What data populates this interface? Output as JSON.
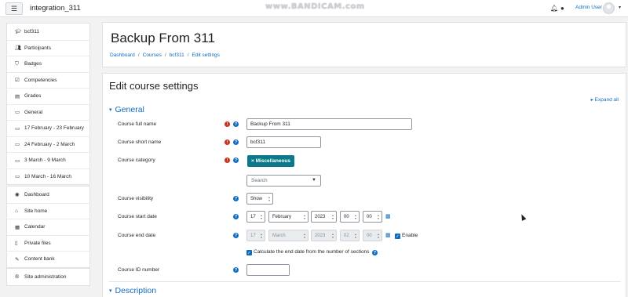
{
  "navbar": {
    "site_name": "integration_311",
    "watermark": "www.BANDICAM.com",
    "user_name": "Admin User",
    "icons": [
      "menu-icon",
      "bell-icon",
      "chat-icon",
      "caret-down-icon"
    ]
  },
  "drawer": {
    "course_items": [
      {
        "label": "bcf311",
        "icon": "graduation-cap-icon"
      },
      {
        "label": "Participants",
        "icon": "users-icon"
      },
      {
        "label": "Badges",
        "icon": "shield-icon"
      },
      {
        "label": "Competencies",
        "icon": "check-square-icon"
      },
      {
        "label": "Grades",
        "icon": "table-icon"
      },
      {
        "label": "General",
        "icon": "folder-icon"
      },
      {
        "label": "17 February - 23 February",
        "icon": "folder-icon"
      },
      {
        "label": "24 February - 2 March",
        "icon": "folder-icon"
      },
      {
        "label": "3 March - 9 March",
        "icon": "folder-icon"
      },
      {
        "label": "10 March - 16 March",
        "icon": "folder-icon"
      }
    ],
    "site_items": [
      {
        "label": "Dashboard",
        "icon": "dashboard-icon"
      },
      {
        "label": "Site home",
        "icon": "home-icon"
      },
      {
        "label": "Calendar",
        "icon": "calendar-icon"
      },
      {
        "label": "Private files",
        "icon": "file-icon"
      },
      {
        "label": "Content bank",
        "icon": "paint-brush-icon"
      }
    ],
    "admin_items": [
      {
        "label": "Site administration",
        "icon": "wrench-icon"
      }
    ]
  },
  "header": {
    "page_title": "Backup From 311",
    "breadcrumb": [
      "Dashboard",
      "Courses",
      "bcf311",
      "Edit settings"
    ]
  },
  "form": {
    "title": "Edit course settings",
    "expand_all": "Expand all",
    "section_general": "General",
    "section_description": "Description",
    "fields": {
      "full_name": {
        "label": "Course full name",
        "value": "Backup From 311"
      },
      "short_name": {
        "label": "Course short name",
        "value": "bcf311"
      },
      "category": {
        "label": "Course category",
        "tag": "Miscellaneous",
        "search_placeholder": "Search"
      },
      "visibility": {
        "label": "Course visibility",
        "value": "Show"
      },
      "start_date": {
        "label": "Course start date",
        "day": "17",
        "month": "February",
        "year": "2023",
        "hour": "00",
        "minute": "00"
      },
      "end_date": {
        "label": "Course end date",
        "day": "17",
        "month": "March",
        "year": "2023",
        "hour": "02",
        "minute": "00",
        "enable_label": "Enable"
      },
      "calc_end_date": {
        "label": "Calculate the end date from the number of sections",
        "checked": true
      },
      "id_number": {
        "label": "Course ID number",
        "value": ""
      }
    }
  },
  "colors": {
    "accent": "#0f6cbf",
    "required": "#ca3120",
    "tag": "#0a7a8a"
  }
}
